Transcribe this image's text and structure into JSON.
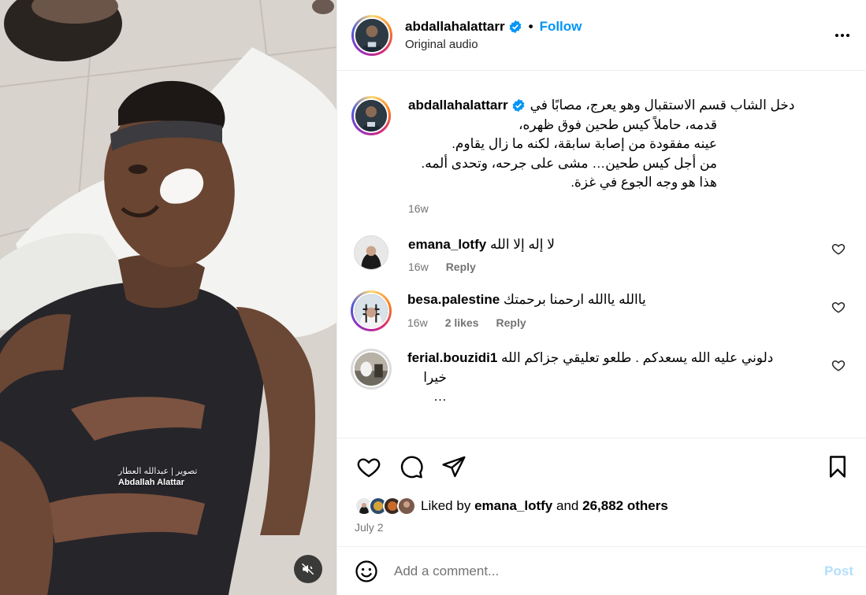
{
  "media": {
    "watermark_arabic": "تصوير | عبدالله العطار",
    "watermark_name": "Abdallah Alattar",
    "mute_icon": "speaker-muted-icon"
  },
  "header": {
    "username": "abdallahalattarr",
    "follow_label": "Follow",
    "separator": "•",
    "audio": "Original audio"
  },
  "caption": {
    "username": "abdallahalattarr",
    "lines": [
      "دخل الشاب قسم الاستقبال وهو يعرج، مصابًا في",
      "قدمه، حاملاً كيس طحين فوق ظهره،",
      "عينه مفقودة من إصابة سابقة، لكنه ما زال يقاوم.",
      "من أجل كيس طحين… مشى على جرحه، وتحدى ألمه.",
      "هذا هو وجه الجوع في غزة."
    ],
    "time": "16w"
  },
  "comments": [
    {
      "username": "emana_lotfy",
      "text": "لا إله إلا الله",
      "time": "16w",
      "likes": "",
      "reply_label": "Reply"
    },
    {
      "username": "besa.palestine",
      "text": "ياالله ياالله ارحمنا برحمتك",
      "time": "16w",
      "likes": "2 likes",
      "reply_label": "Reply"
    },
    {
      "username": "ferial.bouzidi1",
      "text": "دلوني عليه الله يسعدكم . طلعو تعليقي جزاكم الله",
      "text2": "خيرا …"
    }
  ],
  "likes": {
    "prefix": "Liked by",
    "user": "emana_lotfy",
    "and": "and",
    "others": "26,882 others"
  },
  "date": "July 2",
  "composer": {
    "placeholder": "Add a comment...",
    "post_label": "Post"
  },
  "colors": {
    "accent": "#0095f6",
    "post_disabled": "#b2dffc",
    "muted_text": "#737373"
  }
}
